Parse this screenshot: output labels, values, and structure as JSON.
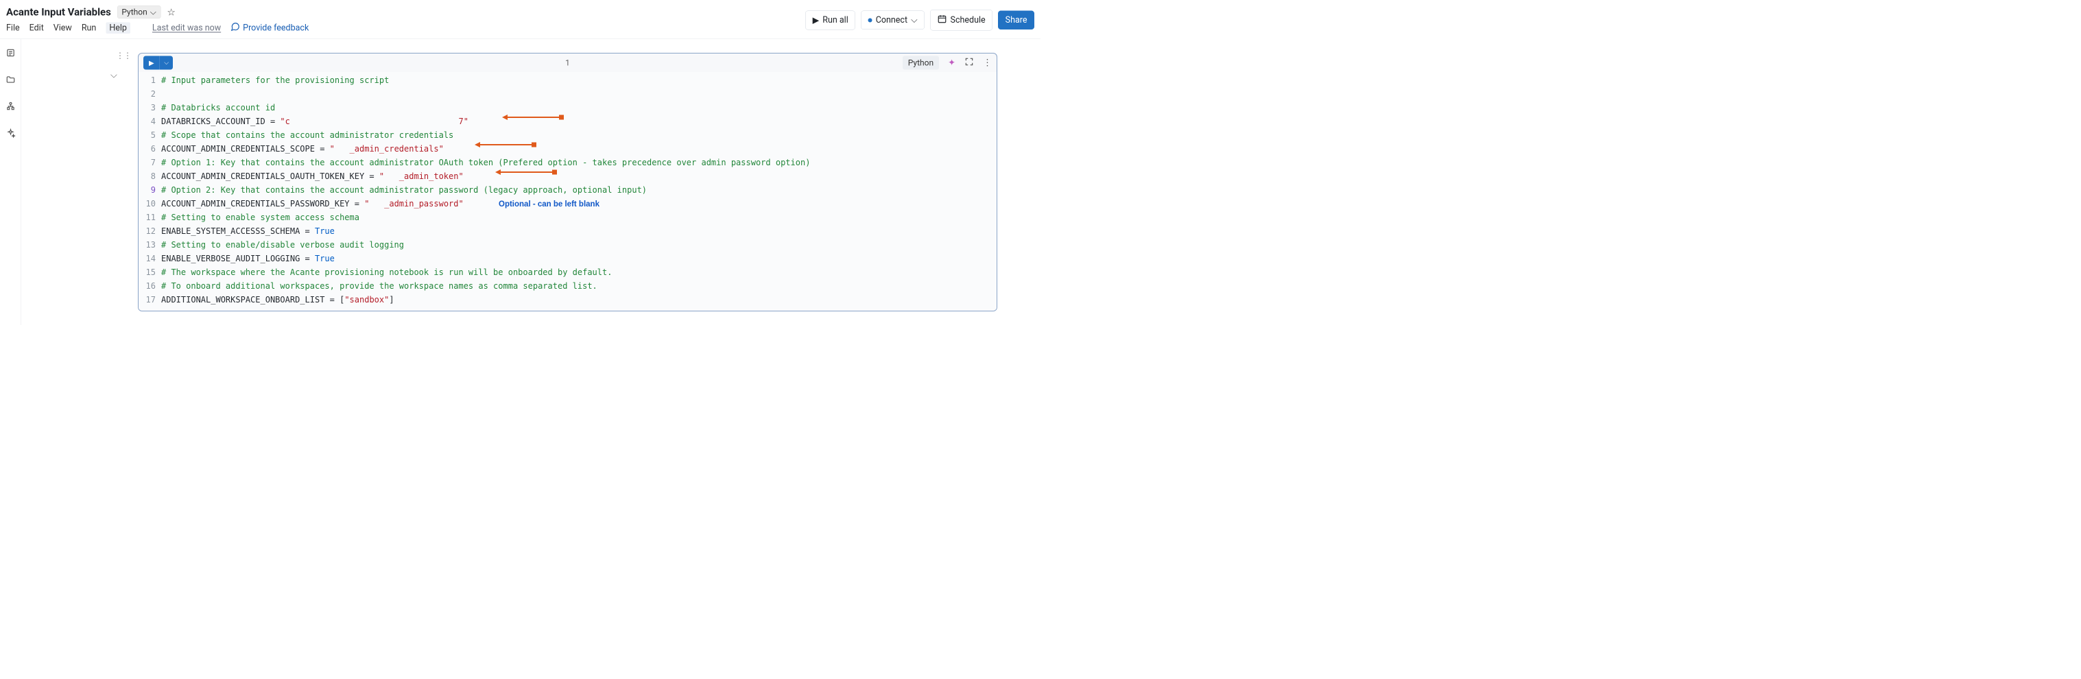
{
  "header": {
    "title": "Acante Input Variables",
    "language": "Python"
  },
  "menu": {
    "file": "File",
    "edit": "Edit",
    "view": "View",
    "run": "Run",
    "help": "Help",
    "last_edit": "Last edit was now",
    "feedback": "Provide feedback"
  },
  "actions": {
    "run_all": "Run all",
    "connect": "Connect",
    "schedule": "Schedule",
    "share": "Share"
  },
  "cell": {
    "index": "1",
    "language": "Python"
  },
  "annot_optional": "Optional - can be left blank",
  "code": {
    "l1_comment": "# Input parameters for the provisioning script",
    "l3_comment": "# Databricks account id",
    "l4_var": "DATABRICKS_ACCOUNT_ID",
    "l4_val": "\"c                                  7\"",
    "l5_comment": "# Scope that contains the account administrator credentials",
    "l6_var": "ACCOUNT_ADMIN_CREDENTIALS_SCOPE",
    "l6_val": "\"   _admin_credentials\"",
    "l7_comment": "# Option 1: Key that contains the account administrator OAuth token (Prefered option - takes precedence over admin password option)",
    "l8_var": "ACCOUNT_ADMIN_CREDENTIALS_OAUTH_TOKEN_KEY",
    "l8_val": "\"   _admin_token\"",
    "l9_comment": "# Option 2: Key that contains the account administrator password (legacy approach, optional input)",
    "l10_var": "ACCOUNT_ADMIN_CREDENTIALS_PASSWORD_KEY",
    "l10_val": "\"   _admin_password\"",
    "l11_comment": "# Setting to enable system access schema",
    "l12_var": "ENABLE_SYSTEM_ACCESSS_SCHEMA",
    "l12_val": "True",
    "l13_comment": "# Setting to enable/disable verbose audit logging",
    "l14_var": "ENABLE_VERBOSE_AUDIT_LOGGING",
    "l14_val": "True",
    "l15_comment": "# The workspace where the Acante provisioning notebook is run will be onboarded by default.",
    "l16_comment": "# To onboard additional workspaces, provide the workspace names as comma separated list.",
    "l17_var": "ADDITIONAL_WORKSPACE_ONBOARD_LIST",
    "l17_val": "\"sandbox\"",
    "eq": " = "
  }
}
